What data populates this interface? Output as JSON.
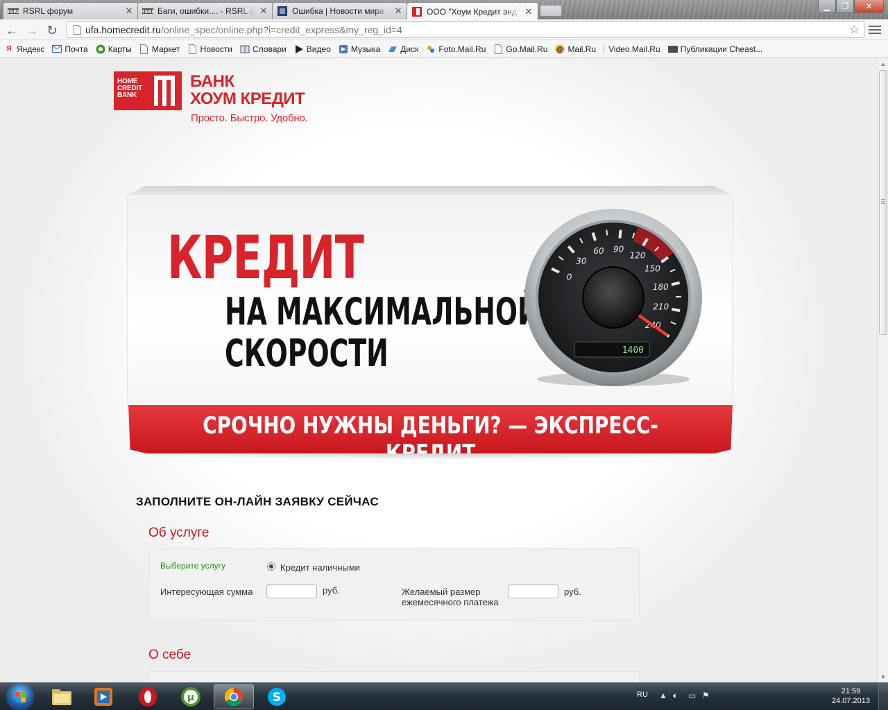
{
  "browser": {
    "tabs": [
      {
        "title": "RSRL форум",
        "icon": "rsrl-favicon",
        "active": false
      },
      {
        "title": "Баги, ошибки.... - RSRL ф",
        "icon": "rsrl-favicon",
        "active": false
      },
      {
        "title": "Ошибка | Новости мира",
        "icon": "news-favicon",
        "active": false
      },
      {
        "title": "ООО \"Хоум Кредит энд Ф",
        "icon": "homecredit-favicon",
        "active": true
      }
    ],
    "url_host": "ufa.homecredit.ru",
    "url_path": "/online_spec/online.php?i=credit_express&my_reg_id=4",
    "bookmarks": [
      {
        "label": "Яндекс",
        "icon": "yandex-icon"
      },
      {
        "label": "Почта",
        "icon": "mail-icon"
      },
      {
        "label": "Карты",
        "icon": "maps-icon"
      },
      {
        "label": "Маркет",
        "icon": "page-icon"
      },
      {
        "label": "Новости",
        "icon": "page-icon"
      },
      {
        "label": "Словари",
        "icon": "dictionary-icon"
      },
      {
        "label": "Видео",
        "icon": "video-icon"
      },
      {
        "label": "Музыка",
        "icon": "music-icon"
      },
      {
        "label": "Диск",
        "icon": "disk-icon"
      },
      {
        "label": "Foto.Mail.Ru",
        "icon": "foto-icon"
      },
      {
        "label": "Go.Mail.Ru",
        "icon": "page-icon"
      },
      {
        "label": "Mail.Ru",
        "icon": "mailru-icon"
      },
      {
        "label": "Video.Mail.Ru",
        "icon": "page-icon"
      },
      {
        "label": "Публикации Cheast...",
        "icon": "rsrl-favicon"
      }
    ]
  },
  "page": {
    "logo": {
      "en_line1": "HOME",
      "en_line2": "CREDIT",
      "en_line3": "BANK",
      "ru_line1": "БАНК",
      "ru_line2": "ХОУМ КРЕДИТ",
      "slogan": "Просто. Быстро. Удобно."
    },
    "banner": {
      "headline": "КРЕДИТ",
      "line1": "НА МАКСИМАЛЬНОЙ",
      "line2": "СКОРОСТИ",
      "ribbon": "СРОЧНО НУЖНЫ ДЕНЬГИ? — ЭКСПРЕСС-КРЕДИТ",
      "speedometer": {
        "ticks": [
          "0",
          "30",
          "60",
          "90",
          "120",
          "150",
          "180",
          "210",
          "240"
        ],
        "display": "1400",
        "needle_value": 240
      }
    },
    "form": {
      "heading": "ЗАПОЛНИТЕ ОН-ЛАЙН ЗАЯВКУ СЕЙЧАС",
      "section1_title": "Об услуге",
      "service_label": "Выберите услугу",
      "service_option": "Кредит наличными",
      "amount_label": "Интересующая сумма",
      "amount_value": "",
      "amount_unit": "руб.",
      "monthly_label_1": "Желаемый размер",
      "monthly_label_2": "ежемесячного платежа",
      "monthly_value": "",
      "monthly_unit": "руб.",
      "section2_title": "О себе"
    }
  },
  "taskbar": {
    "apps": [
      "explorer-icon",
      "media-player-icon",
      "opera-icon",
      "utorrent-icon",
      "chrome-icon",
      "skype-icon"
    ],
    "active_app": "chrome-icon",
    "language": "RU",
    "time": "21:59",
    "date": "24.07.2013"
  },
  "colors": {
    "brand_red": "#d8232a",
    "ribbon_red": "#c8161d",
    "label_green": "#2b8a1e"
  }
}
